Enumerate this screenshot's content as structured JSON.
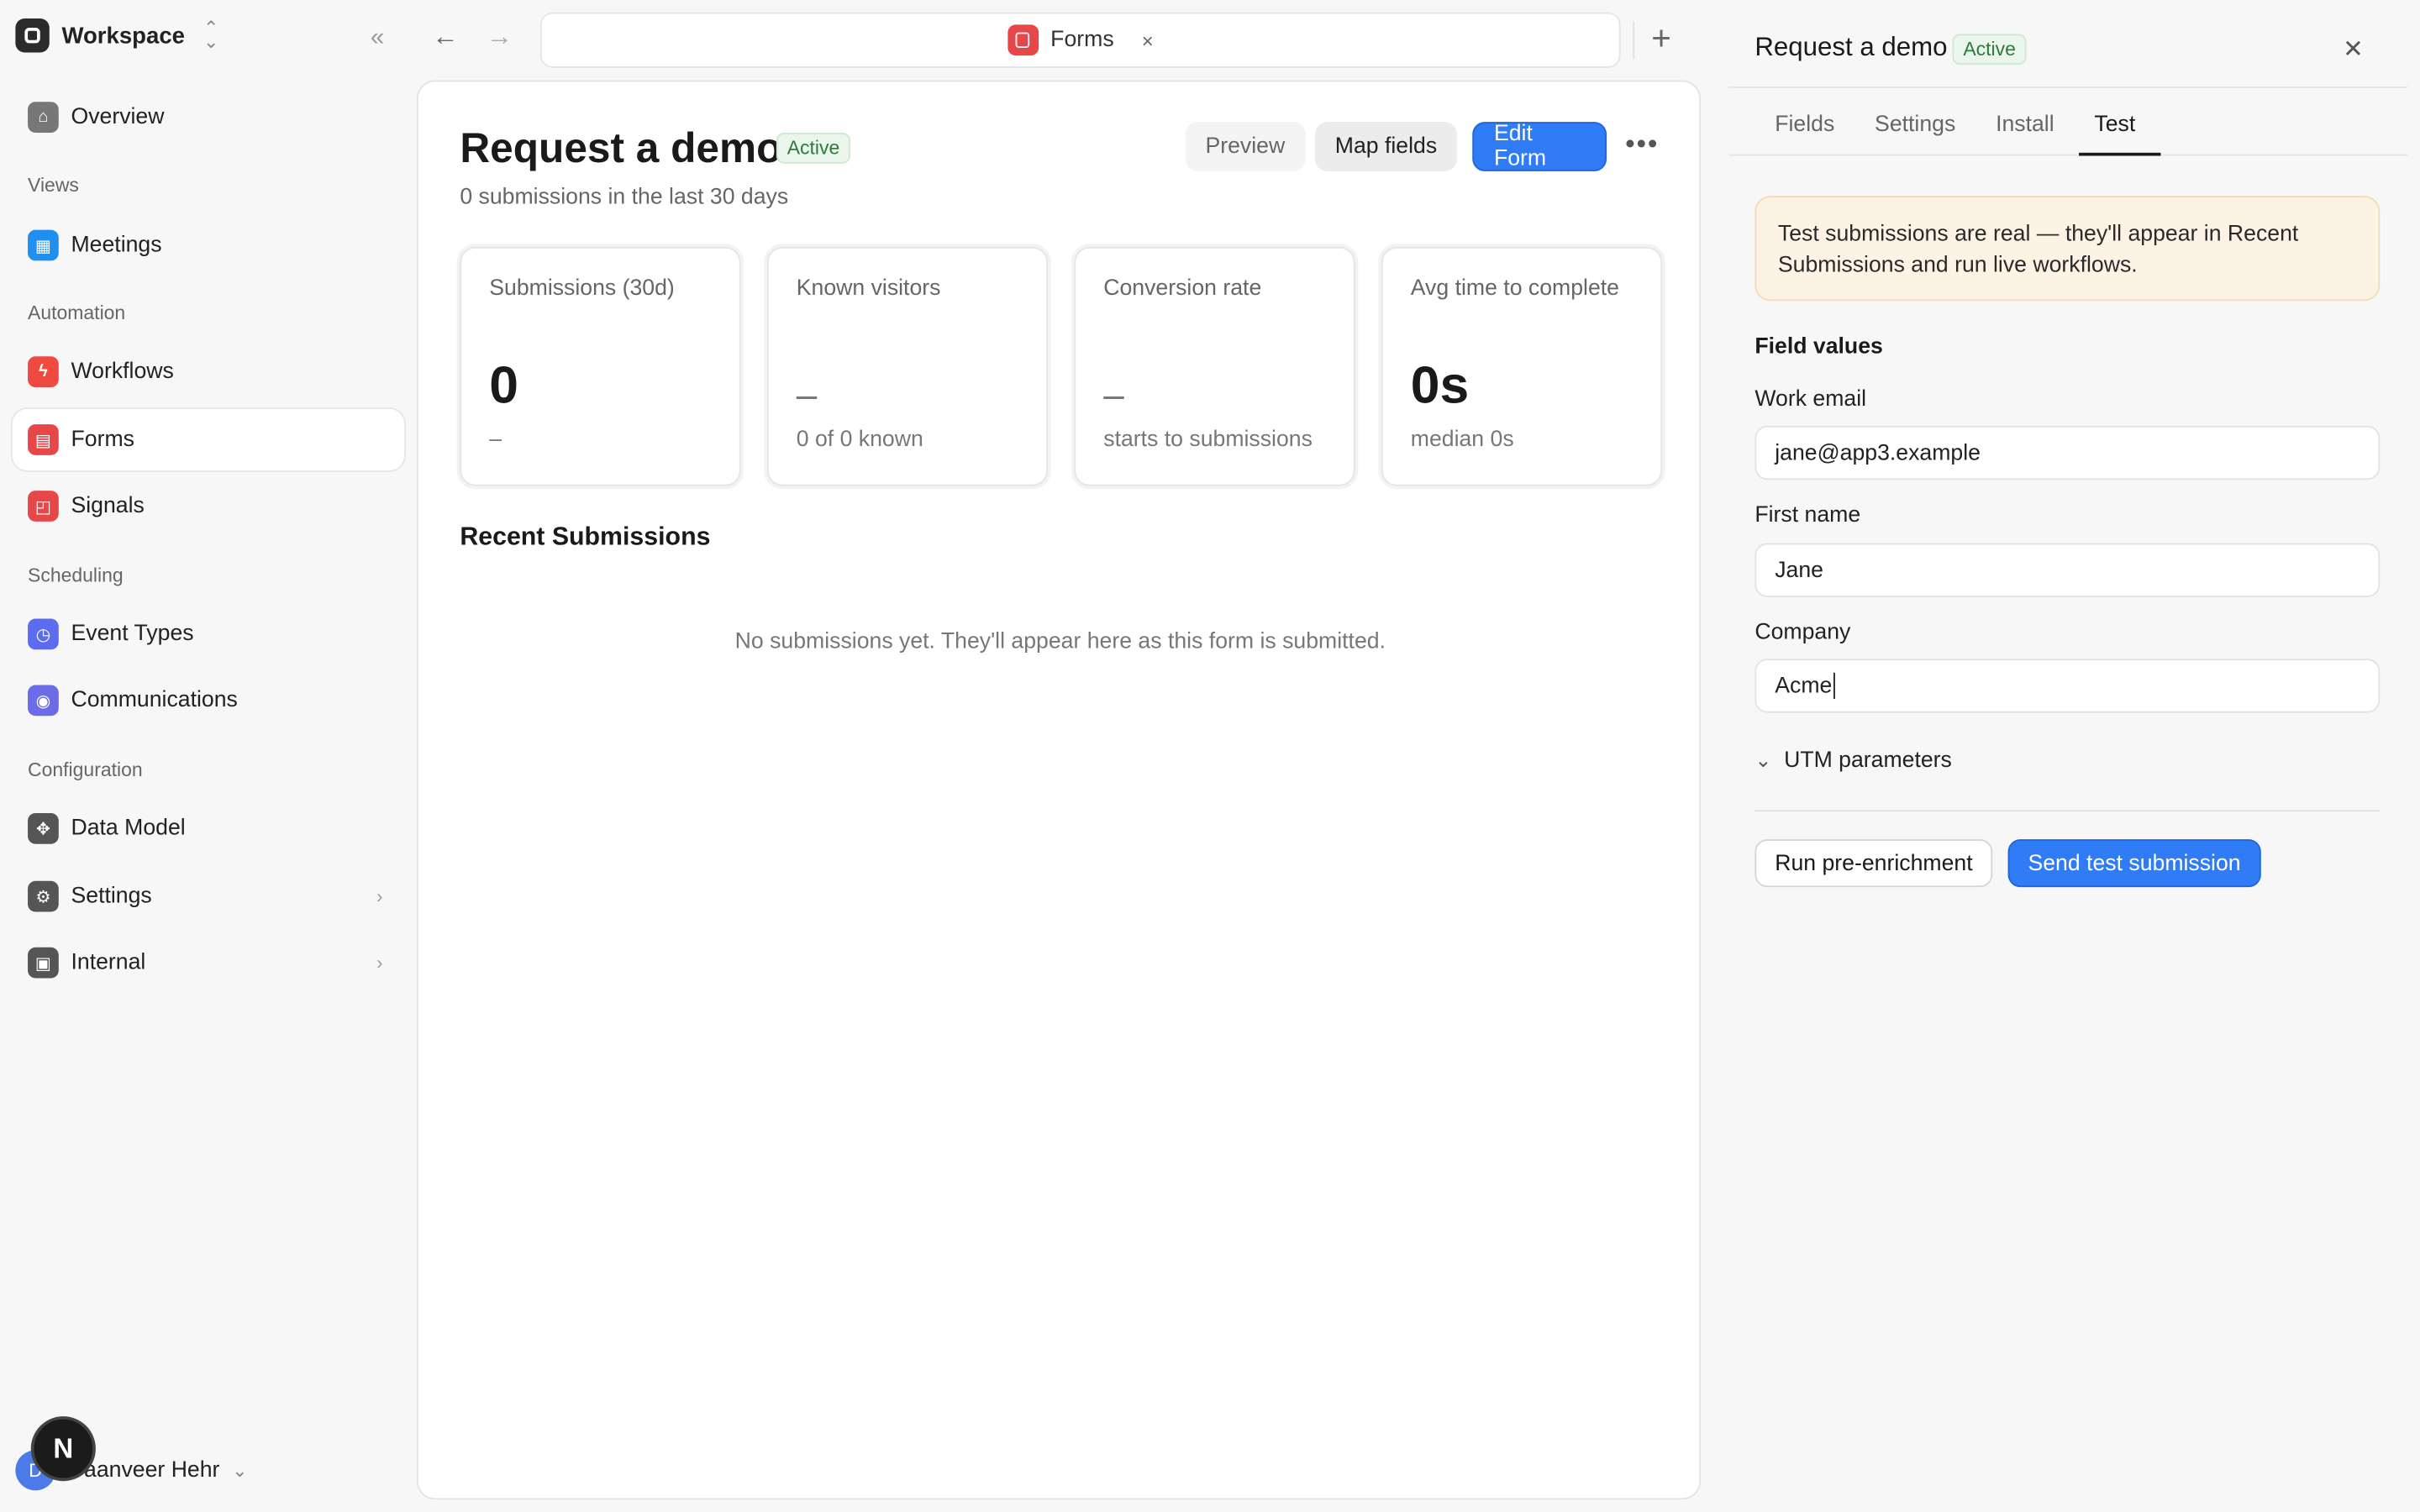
{
  "sidebar": {
    "workspace": "Workspace",
    "items": [
      {
        "label": "Overview"
      },
      {
        "label": "Meetings"
      },
      {
        "label": "Workflows"
      },
      {
        "label": "Forms"
      },
      {
        "label": "Signals"
      },
      {
        "label": "Event Types"
      },
      {
        "label": "Communications"
      },
      {
        "label": "Data Model"
      },
      {
        "label": "Settings"
      },
      {
        "label": "Internal"
      }
    ],
    "sections": {
      "views": "Views",
      "automation": "Automation",
      "scheduling": "Scheduling",
      "configuration": "Configuration"
    },
    "user": {
      "initial": "D",
      "name": "Daanveer Hehr"
    },
    "badge": "N"
  },
  "topbar": {
    "tab_label": "Forms",
    "tab_close": "×"
  },
  "main": {
    "title": "Request a demo",
    "status": "Active",
    "subtitle": "0 submissions in the last 30 days",
    "buttons": {
      "preview": "Preview",
      "map_fields": "Map fields",
      "edit_form": "Edit Form"
    },
    "stats": [
      {
        "label": "Submissions (30d)",
        "value": "0",
        "sub": "–"
      },
      {
        "label": "Known visitors",
        "value": "–",
        "sub": "0 of 0 known"
      },
      {
        "label": "Conversion rate",
        "value": "–",
        "sub": "starts to submissions"
      },
      {
        "label": "Avg time to complete",
        "value": "0s",
        "sub": "median 0s"
      }
    ],
    "recent_title": "Recent Submissions",
    "empty_text": "No submissions yet. They'll appear here as this form is submitted."
  },
  "panel": {
    "title": "Request a demo",
    "status": "Active",
    "tabs": [
      "Fields",
      "Settings",
      "Install",
      "Test"
    ],
    "notice": "Test submissions are real — they'll appear in Recent Submissions and run live workflows.",
    "field_values_label": "Field values",
    "fields": [
      {
        "label": "Work email",
        "value": "jane@app3.example"
      },
      {
        "label": "First name",
        "value": "Jane"
      },
      {
        "label": "Company",
        "value": "Acme"
      }
    ],
    "utm_label": "UTM parameters",
    "buttons": {
      "pre_enrich": "Run pre-enrichment",
      "send": "Send test submission"
    }
  },
  "colors": {
    "accent": "#2f7cf6",
    "forms_red": "#e8474a",
    "active_green": "#2f7a3b"
  }
}
